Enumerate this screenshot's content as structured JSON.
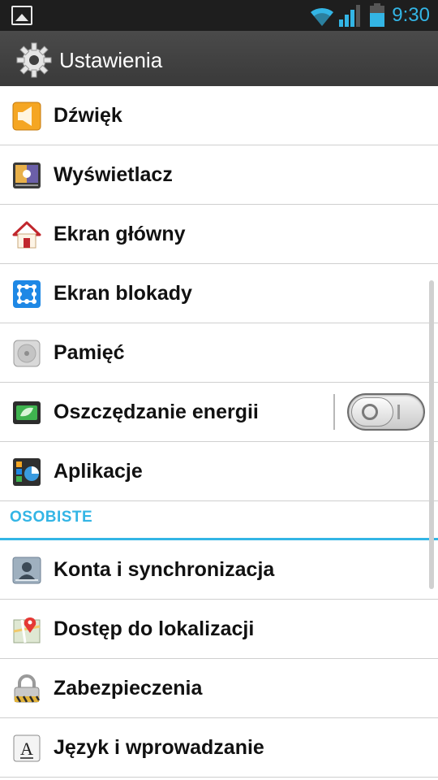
{
  "statusbar": {
    "time": "9:30",
    "icons": [
      "gallery-icon",
      "wifi-icon",
      "signal-icon",
      "battery-icon"
    ]
  },
  "actionbar": {
    "title": "Ustawienia",
    "icon": "gear-icon"
  },
  "items_top": [
    {
      "label": "Dźwięk",
      "icon": "speaker-icon"
    },
    {
      "label": "Wyświetlacz",
      "icon": "display-icon"
    },
    {
      "label": "Ekran główny",
      "icon": "home-icon"
    },
    {
      "label": "Ekran blokady",
      "icon": "lock-pattern-icon"
    },
    {
      "label": "Pamięć",
      "icon": "storage-icon"
    },
    {
      "label": "Oszczędzanie energii",
      "icon": "battery-saver-icon",
      "toggle": "off"
    },
    {
      "label": "Aplikacje",
      "icon": "apps-icon"
    }
  ],
  "section": {
    "label": "OSOBISTE"
  },
  "items_personal": [
    {
      "label": "Konta i synchronizacja",
      "icon": "account-icon"
    },
    {
      "label": "Dostęp do lokalizacji",
      "icon": "location-map-icon"
    },
    {
      "label": "Zabezpieczenia",
      "icon": "padlock-icon"
    },
    {
      "label": "Język i wprowadzanie",
      "icon": "language-icon"
    }
  ],
  "colors": {
    "accent": "#33b5e5",
    "actionbar": "#404040",
    "statusbar": "#1e1e1e"
  }
}
